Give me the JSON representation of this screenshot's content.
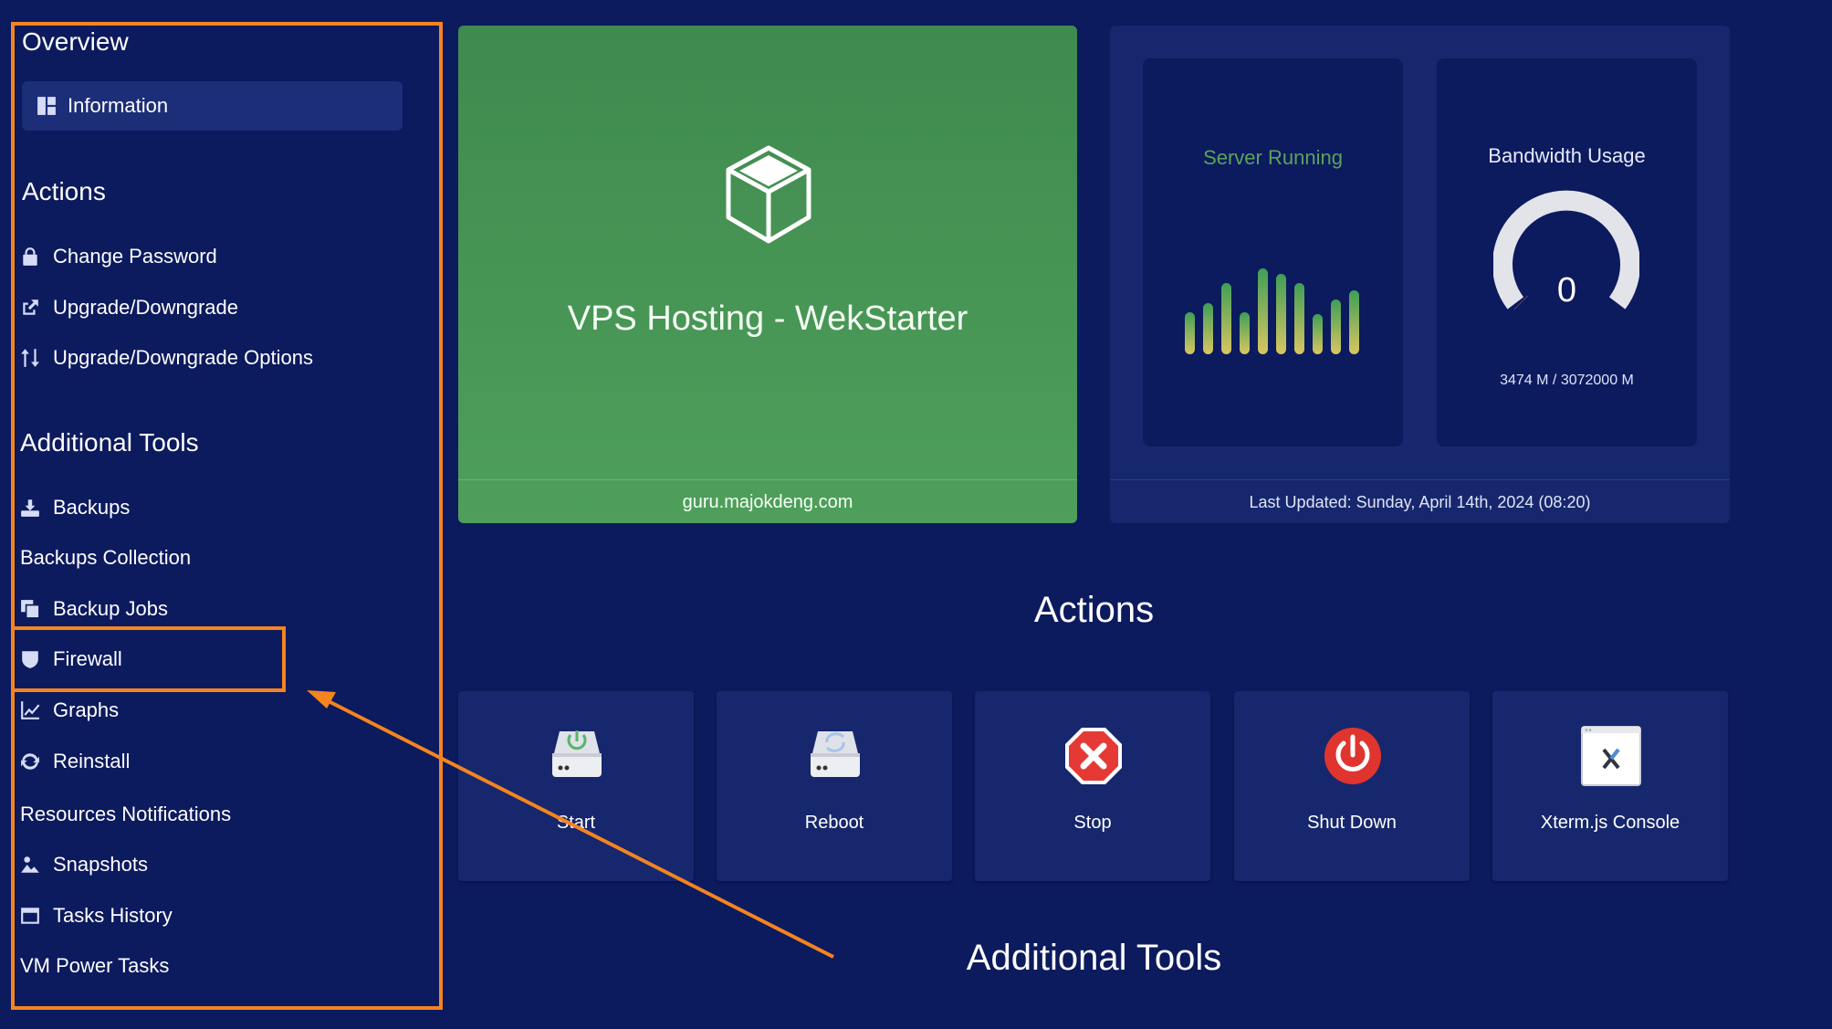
{
  "sidebar": {
    "overview_title": "Overview",
    "information_label": "Information",
    "actions_title": "Actions",
    "actions_items": [
      {
        "label": "Change Password",
        "icon": "lock-icon"
      },
      {
        "label": "Upgrade/Downgrade",
        "icon": "external-link-icon"
      },
      {
        "label": "Upgrade/Downgrade Options",
        "icon": "sort-arrows-icon"
      }
    ],
    "tools_title": "Additional Tools",
    "tools_items": [
      {
        "label": "Backups",
        "icon": "backup-drive-icon"
      },
      {
        "label": "Backups Collection",
        "icon": ""
      },
      {
        "label": "Backup Jobs",
        "icon": "copy-icon"
      },
      {
        "label": "Firewall",
        "icon": "shield-icon"
      },
      {
        "label": "Graphs",
        "icon": "line-chart-icon"
      },
      {
        "label": "Reinstall",
        "icon": "refresh-icon"
      },
      {
        "label": "Resources Notifications",
        "icon": ""
      },
      {
        "label": "Snapshots",
        "icon": "image-icon"
      },
      {
        "label": "Tasks History",
        "icon": "window-icon"
      },
      {
        "label": "VM Power Tasks",
        "icon": ""
      }
    ]
  },
  "product": {
    "name": "VPS Hosting - WekStarter",
    "hostname": "guru.majokdeng.com",
    "icon": "cube-icon"
  },
  "status": {
    "server_label": "Server Running",
    "bandwidth_label": "Bandwidth Usage",
    "bandwidth_value": "0",
    "bandwidth_detail": "3474 M / 3072000 M",
    "bandwidth_fraction": 0.0011,
    "last_updated": "Last Updated: Sunday, April 14th, 2024 (08:20)"
  },
  "main": {
    "actions_heading": "Actions",
    "tools_heading": "Additional Tools",
    "actions": [
      {
        "label": "Start",
        "icon": "start-drive-icon"
      },
      {
        "label": "Reboot",
        "icon": "reboot-drive-icon"
      },
      {
        "label": "Stop",
        "icon": "stop-icon"
      },
      {
        "label": "Shut Down",
        "icon": "power-icon"
      },
      {
        "label": "Xterm.js Console",
        "icon": "terminal-window-icon"
      }
    ]
  },
  "colors": {
    "background": "#0c1a5e",
    "panel": "#16276d",
    "product_green": "#4a9857",
    "highlight_orange": "#f5841f",
    "server_running_green": "#5aa35c",
    "stop_red": "#e53935"
  }
}
